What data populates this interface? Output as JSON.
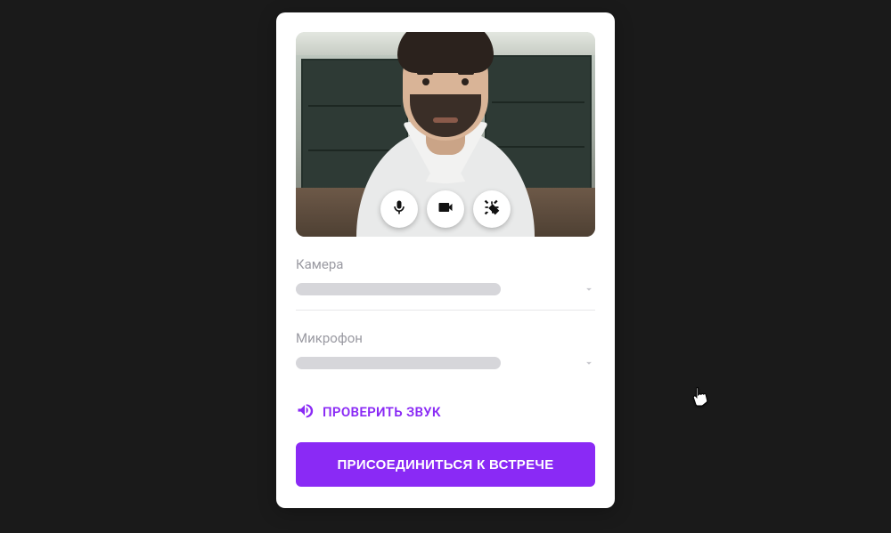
{
  "accent_color": "#8a2af5",
  "preview": {
    "mic_icon": "microphone-icon",
    "camera_icon": "video-camera-icon",
    "effects_icon": "magic-wand-icon"
  },
  "fields": {
    "camera_label": "Камера",
    "microphone_label": "Микрофон"
  },
  "sound_check_label": "ПРОВЕРИТЬ ЗВУК",
  "join_label": "ПРИСОЕДИНИТЬСЯ К ВСТРЕЧЕ"
}
